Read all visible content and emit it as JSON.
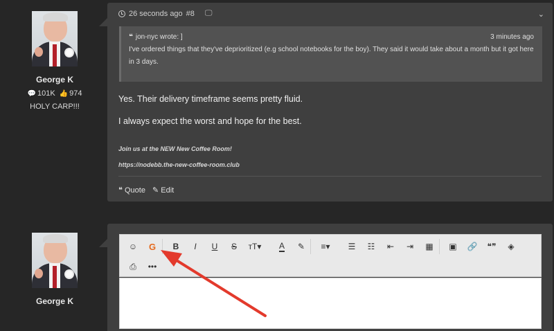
{
  "authors": [
    {
      "name": "George K",
      "posts": "101K",
      "reputation": "974",
      "signature": "HOLY CARP!!!"
    },
    {
      "name": "George K"
    }
  ],
  "post": {
    "timestamp": "26 seconds ago",
    "index": "#8",
    "quote": {
      "author": "jon-nyc wrote: ]",
      "time": "3 minutes ago",
      "text": "I've ordered things that they've deprioritized (e.g school notebooks for the boy).   They said it would take about a month but it got here in 3 days."
    },
    "body": [
      "Yes. Their delivery timeframe seems pretty fluid.",
      "I always expect the worst and hope for the best."
    ],
    "signature_lines": [
      "Join us at the NEW New Coffee Room!",
      "https://nodebb.the-new-coffee-room.club"
    ],
    "actions": {
      "quote": "Quote",
      "edit": "Edit"
    }
  },
  "toolbar": {
    "row1": [
      {
        "name": "emoji",
        "glyph": "☺"
      },
      {
        "name": "grammarly",
        "glyph": "G"
      },
      {
        "name": "bold",
        "glyph": "B"
      },
      {
        "name": "italic",
        "glyph": "I"
      },
      {
        "name": "underline",
        "glyph": "U"
      },
      {
        "name": "strikethrough",
        "glyph": "S"
      },
      {
        "name": "text-size",
        "glyph": "тТ▾"
      },
      {
        "name": "font-color",
        "glyph": "A"
      },
      {
        "name": "highlight",
        "glyph": "✎"
      },
      {
        "name": "align",
        "glyph": "≡▾"
      },
      {
        "name": "bulleted-list",
        "glyph": "☰"
      },
      {
        "name": "numbered-list",
        "glyph": "☷"
      },
      {
        "name": "outdent",
        "glyph": "⇤"
      },
      {
        "name": "indent",
        "glyph": "⇥"
      },
      {
        "name": "table",
        "glyph": "▦"
      },
      {
        "name": "image",
        "glyph": "▣"
      },
      {
        "name": "link",
        "glyph": "🔗"
      },
      {
        "name": "blockquote",
        "glyph": "❝❞"
      },
      {
        "name": "spoiler",
        "glyph": "◈"
      }
    ],
    "row2": [
      {
        "name": "upload-file",
        "glyph": "⎙"
      },
      {
        "name": "more",
        "glyph": "•••"
      }
    ]
  },
  "colors": {
    "page_bg": "#262626",
    "panel_bg": "#3f3f3f",
    "quote_bg": "#525252",
    "toolbar_bg": "#e9e9e9",
    "grammarly": "#e56a1e",
    "arrow": "#e33a2c"
  }
}
